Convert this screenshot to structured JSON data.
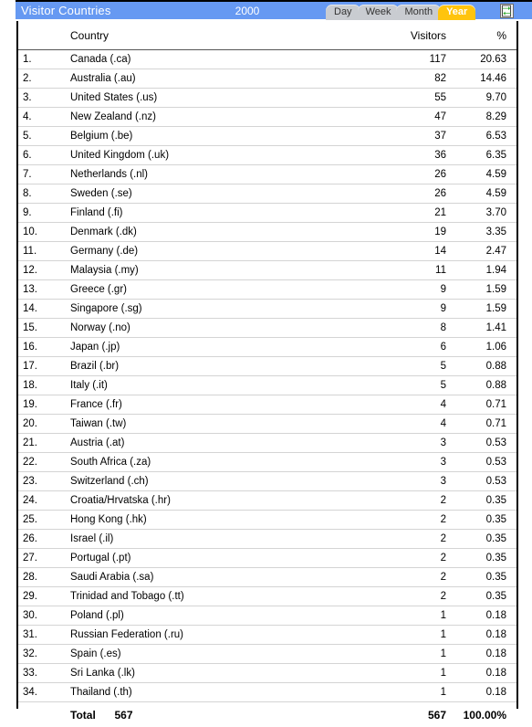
{
  "window": {
    "title": "Visitor Countries",
    "period": "2000",
    "accent_blue": "#6699f2",
    "accent_yellow": "#ffc40d"
  },
  "tabs": [
    {
      "label": "Day",
      "active": false
    },
    {
      "label": "Week",
      "active": false
    },
    {
      "label": "Month",
      "active": false
    },
    {
      "label": "Year",
      "active": true
    }
  ],
  "toolbar": {
    "refresh_icon": "refresh-page-icon"
  },
  "table": {
    "headers": {
      "rank": "",
      "country": "Country",
      "visitors": "Visitors",
      "percent": "%"
    },
    "rows": [
      {
        "rank": "1.",
        "country": "Canada (.ca)",
        "visitors": "117",
        "percent": "20.63"
      },
      {
        "rank": "2.",
        "country": "Australia (.au)",
        "visitors": "82",
        "percent": "14.46"
      },
      {
        "rank": "3.",
        "country": "United States (.us)",
        "visitors": "55",
        "percent": "9.70"
      },
      {
        "rank": "4.",
        "country": "New Zealand (.nz)",
        "visitors": "47",
        "percent": "8.29"
      },
      {
        "rank": "5.",
        "country": "Belgium (.be)",
        "visitors": "37",
        "percent": "6.53"
      },
      {
        "rank": "6.",
        "country": "United Kingdom (.uk)",
        "visitors": "36",
        "percent": "6.35"
      },
      {
        "rank": "7.",
        "country": "Netherlands (.nl)",
        "visitors": "26",
        "percent": "4.59"
      },
      {
        "rank": "8.",
        "country": "Sweden (.se)",
        "visitors": "26",
        "percent": "4.59"
      },
      {
        "rank": "9.",
        "country": "Finland (.fi)",
        "visitors": "21",
        "percent": "3.70"
      },
      {
        "rank": "10.",
        "country": "Denmark (.dk)",
        "visitors": "19",
        "percent": "3.35"
      },
      {
        "rank": "11.",
        "country": "Germany (.de)",
        "visitors": "14",
        "percent": "2.47"
      },
      {
        "rank": "12.",
        "country": "Malaysia (.my)",
        "visitors": "11",
        "percent": "1.94"
      },
      {
        "rank": "13.",
        "country": "Greece (.gr)",
        "visitors": "9",
        "percent": "1.59"
      },
      {
        "rank": "14.",
        "country": "Singapore (.sg)",
        "visitors": "9",
        "percent": "1.59"
      },
      {
        "rank": "15.",
        "country": "Norway (.no)",
        "visitors": "8",
        "percent": "1.41"
      },
      {
        "rank": "16.",
        "country": "Japan (.jp)",
        "visitors": "6",
        "percent": "1.06"
      },
      {
        "rank": "17.",
        "country": "Brazil (.br)",
        "visitors": "5",
        "percent": "0.88"
      },
      {
        "rank": "18.",
        "country": "Italy (.it)",
        "visitors": "5",
        "percent": "0.88"
      },
      {
        "rank": "19.",
        "country": "France (.fr)",
        "visitors": "4",
        "percent": "0.71"
      },
      {
        "rank": "20.",
        "country": "Taiwan (.tw)",
        "visitors": "4",
        "percent": "0.71"
      },
      {
        "rank": "21.",
        "country": "Austria (.at)",
        "visitors": "3",
        "percent": "0.53"
      },
      {
        "rank": "22.",
        "country": "South Africa (.za)",
        "visitors": "3",
        "percent": "0.53"
      },
      {
        "rank": "23.",
        "country": "Switzerland (.ch)",
        "visitors": "3",
        "percent": "0.53"
      },
      {
        "rank": "24.",
        "country": "Croatia/Hrvatska (.hr)",
        "visitors": "2",
        "percent": "0.35"
      },
      {
        "rank": "25.",
        "country": "Hong Kong (.hk)",
        "visitors": "2",
        "percent": "0.35"
      },
      {
        "rank": "26.",
        "country": "Israel (.il)",
        "visitors": "2",
        "percent": "0.35"
      },
      {
        "rank": "27.",
        "country": "Portugal (.pt)",
        "visitors": "2",
        "percent": "0.35"
      },
      {
        "rank": "28.",
        "country": "Saudi Arabia (.sa)",
        "visitors": "2",
        "percent": "0.35"
      },
      {
        "rank": "29.",
        "country": "Trinidad and Tobago (.tt)",
        "visitors": "2",
        "percent": "0.35"
      },
      {
        "rank": "30.",
        "country": "Poland (.pl)",
        "visitors": "1",
        "percent": "0.18"
      },
      {
        "rank": "31.",
        "country": "Russian Federation (.ru)",
        "visitors": "1",
        "percent": "0.18"
      },
      {
        "rank": "32.",
        "country": "Spain (.es)",
        "visitors": "1",
        "percent": "0.18"
      },
      {
        "rank": "33.",
        "country": "Sri Lanka (.lk)",
        "visitors": "1",
        "percent": "0.18"
      },
      {
        "rank": "34.",
        "country": "Thailand (.th)",
        "visitors": "1",
        "percent": "0.18"
      }
    ],
    "footer": {
      "label": "Total",
      "count_inline": "567",
      "visitors_total": "567",
      "percent_total": "100.00%"
    }
  }
}
